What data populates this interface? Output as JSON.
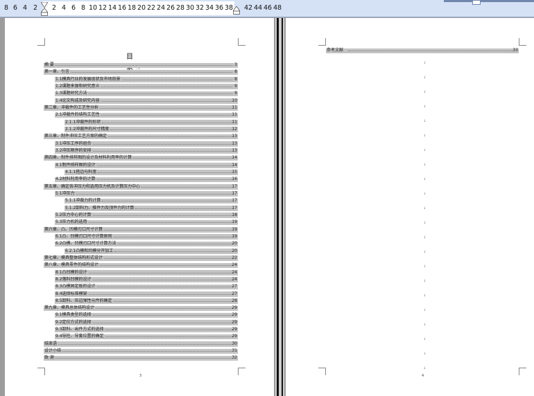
{
  "ruler": {
    "ticks": [
      "8",
      "6",
      "4",
      "2",
      "2",
      "4",
      "6",
      "8",
      "10",
      "12",
      "14",
      "16",
      "18",
      "20",
      "22",
      "24",
      "26",
      "28",
      "30",
      "32",
      "34",
      "36",
      "38",
      "42",
      "44",
      "46",
      "48"
    ]
  },
  "page_left": {
    "toc_title": "目    录",
    "paragraph_mark": ".↓",
    "entries": [
      {
        "text": "摘    要",
        "page": "3"
      },
      {
        "text": "第一章、引言",
        "page": "8"
      },
      {
        "text": "1.1模具行业的发展现状及市场前景",
        "page": "8"
      },
      {
        "text": "1.2课题来源和研究意义",
        "page": "9"
      },
      {
        "text": "1.3课题研究方法",
        "page": "9"
      },
      {
        "text": "1.4论文构成及研究内容",
        "page": "10"
      },
      {
        "text": "第二章、冲裁件的工艺性分析",
        "page": "11"
      },
      {
        "text": "2.1冲裁件的结构工艺性",
        "page": "11"
      },
      {
        "text": "2.1.1冲裁件的形状",
        "page": "11"
      },
      {
        "text": "2.1.2冲裁件的尺寸精度",
        "page": "12"
      },
      {
        "text": "第三章、制件冲压工艺方案的确定",
        "page": "13"
      },
      {
        "text": "3.1冲压工序的组合",
        "page": "13"
      },
      {
        "text": "3.2冲压顺序的安排",
        "page": "13"
      },
      {
        "text": "第四章、制件排样图的设计及材料利用率的计算",
        "page": "14"
      },
      {
        "text": "4.1制件排样图的设计",
        "page": "14"
      },
      {
        "text": "4.1.1搭边与料宽",
        "page": "15"
      },
      {
        "text": "4.2材料利用率的计算",
        "page": "16"
      },
      {
        "text": "第五章、确定各冲压力和选用压力机及计算压力中心",
        "page": "17"
      },
      {
        "text": "5.1冲压力",
        "page": "17"
      },
      {
        "text": "5.1.1冲裁力的计算",
        "page": "17"
      },
      {
        "text": "5.1.2卸料力、推件力及顶件力的计算",
        "page": "17"
      },
      {
        "text": "5.2压力中心的计算",
        "page": "18"
      },
      {
        "text": "5.3压力机的选用",
        "page": "19"
      },
      {
        "text": "第六章、凸、凹模刃口尺寸计算",
        "page": "19"
      },
      {
        "text": "6.1凸、凹模刃口尺寸计算原则",
        "page": "19"
      },
      {
        "text": "6.2凸模、凹模刃口尺寸计算方法",
        "page": "20"
      },
      {
        "text": "6.2.1凸模和凹模分开加工",
        "page": "20"
      },
      {
        "text": "第七章、模具整体结构形式设计",
        "page": "22"
      },
      {
        "text": "第八章、模具零件的结构设计",
        "page": "24"
      },
      {
        "text": "8.1凸凹模的设计",
        "page": "24"
      },
      {
        "text": "8.2落料凹模的设计",
        "page": "24"
      },
      {
        "text": "8.3凸模固定板的设计",
        "page": "27"
      },
      {
        "text": "8.4选择标准模架",
        "page": "27"
      },
      {
        "text": "8.5卸料、压边弹性元件的确定",
        "page": "28"
      },
      {
        "text": "第九章、模具总体结构设计",
        "page": "29"
      },
      {
        "text": "9.1模具类型的选择",
        "page": "29"
      },
      {
        "text": "9.2定位方式的选择",
        "page": "29"
      },
      {
        "text": "9.3卸料、出件方式的选择",
        "page": "29"
      },
      {
        "text": "9.4导柱、导套位置的确定",
        "page": "29"
      },
      {
        "text": "结束语",
        "page": "30"
      },
      {
        "text": "设计小结",
        "page": "31"
      },
      {
        "text": "致    谢",
        "page": "32"
      }
    ],
    "page_number": "3"
  },
  "page_right": {
    "ref_text": "参考文献",
    "ref_page": "33",
    "paragraph_mark": "↓",
    "page_number": "4"
  }
}
